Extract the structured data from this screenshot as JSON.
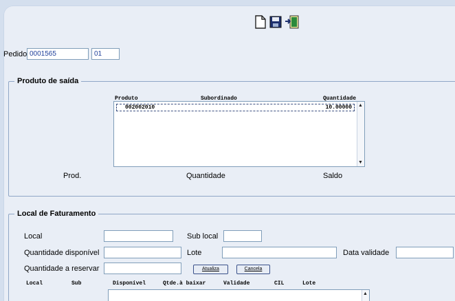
{
  "toolbar": {
    "icons": [
      "new-document-icon",
      "save-icon",
      "exit-icon"
    ]
  },
  "pedido": {
    "label": "Pedido",
    "number": "0001565",
    "seq": "01"
  },
  "produto_saida": {
    "title": "Produto de saída",
    "columns": [
      "Produto",
      "Subordinado",
      "Quantidade"
    ],
    "rows": [
      {
        "produto": "002002010",
        "subordinado": "",
        "quantidade": "10.00000"
      }
    ],
    "footer": {
      "prod": "Prod.",
      "quantidade": "Quantidade",
      "saldo": "Saldo"
    }
  },
  "local_faturamento": {
    "title": "Local de Faturamento",
    "local_label": "Local",
    "sub_local_label": "Sub local",
    "qtd_disponivel_label": "Quantidade disponível",
    "lote_label": "Lote",
    "data_validade_label": "Data validade",
    "qtd_reservar_label": "Quantidade a reservar",
    "atualiza": "Atualiza",
    "cancela": "Cancela",
    "columns": [
      "Local",
      "Sub",
      "Disponível",
      "Qtde.à baixar",
      "Validade",
      "CIL",
      "Lote"
    ]
  },
  "colors": {
    "background": "#d4dfee",
    "panel": "#e9eef6",
    "border": "#8fa6c6",
    "input_border": "#7f9db9"
  }
}
